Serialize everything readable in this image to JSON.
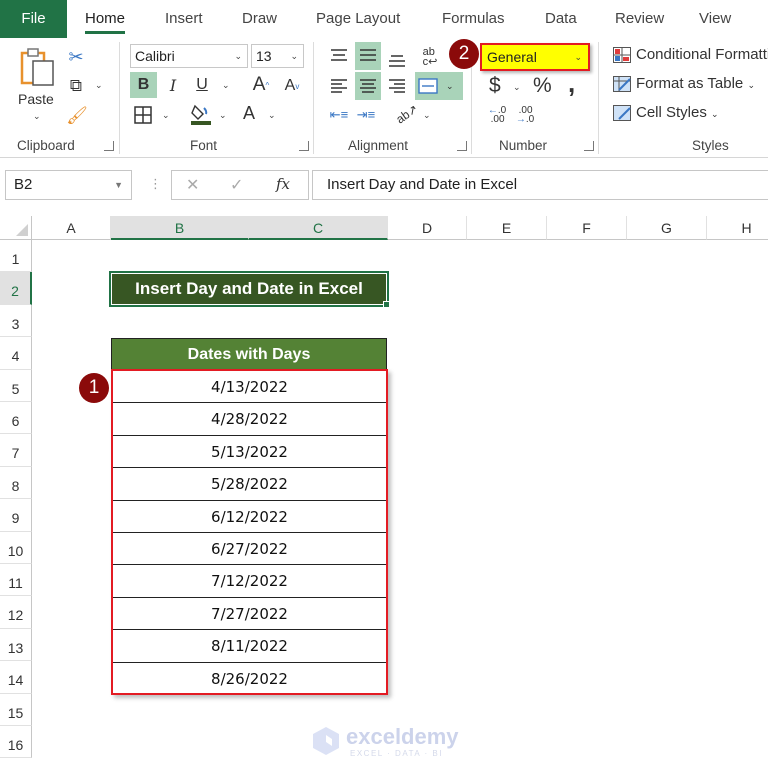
{
  "tabs": [
    "File",
    "Home",
    "Insert",
    "Draw",
    "Page Layout",
    "Formulas",
    "Data",
    "Review",
    "View"
  ],
  "active_tab": "Home",
  "ribbon": {
    "clipboard": {
      "paste_label": "Paste",
      "group_label": "Clipboard"
    },
    "font": {
      "font_name": "Calibri",
      "font_size": "13",
      "group_label": "Font",
      "bold": "B",
      "italic": "I",
      "underline": "U",
      "grow": "A",
      "shrink": "A",
      "font_color": "A"
    },
    "alignment": {
      "group_label": "Alignment"
    },
    "number": {
      "format_value": "General",
      "group_label": "Number",
      "currency": "$",
      "percent": "%",
      "comma": ",",
      "inc_decimal": "←.0 .00",
      "dec_decimal": ".00 →.0"
    },
    "styles": {
      "group_label": "Styles",
      "conditional_formatting": "Conditional Formatting",
      "format_as_table": "Format as Table",
      "cell_styles": "Cell Styles"
    }
  },
  "formula_bar": {
    "name_box": "B2",
    "cancel": "✕",
    "enter": "✓",
    "fx": "fx",
    "content": "Insert Day and Date in Excel"
  },
  "columns": [
    "A",
    "B",
    "C",
    "D",
    "E",
    "F",
    "G",
    "H"
  ],
  "selected_columns": [
    "B",
    "C"
  ],
  "rows": [
    "1",
    "2",
    "3",
    "4",
    "5",
    "6",
    "7",
    "8",
    "9",
    "10",
    "11",
    "12",
    "13",
    "14",
    "15",
    "16"
  ],
  "selected_row": "2",
  "sheet": {
    "title": "Insert Day and Date in Excel",
    "table_header": "Dates with Days",
    "dates": [
      "4/13/2022",
      "4/28/2022",
      "5/13/2022",
      "5/28/2022",
      "6/12/2022",
      "6/27/2022",
      "7/12/2022",
      "7/27/2022",
      "8/11/2022",
      "8/26/2022"
    ]
  },
  "annotations": {
    "step1": "1",
    "step2": "2"
  },
  "watermark": {
    "name": "exceldemy",
    "tagline": "EXCEL · DATA · BI"
  },
  "colors": {
    "excel_green": "#217346",
    "title_fill": "#375623",
    "header_fill": "#548235",
    "highlight_red": "#e31b23",
    "badge": "#8b0a0a",
    "general_fill": "#ffff00"
  }
}
